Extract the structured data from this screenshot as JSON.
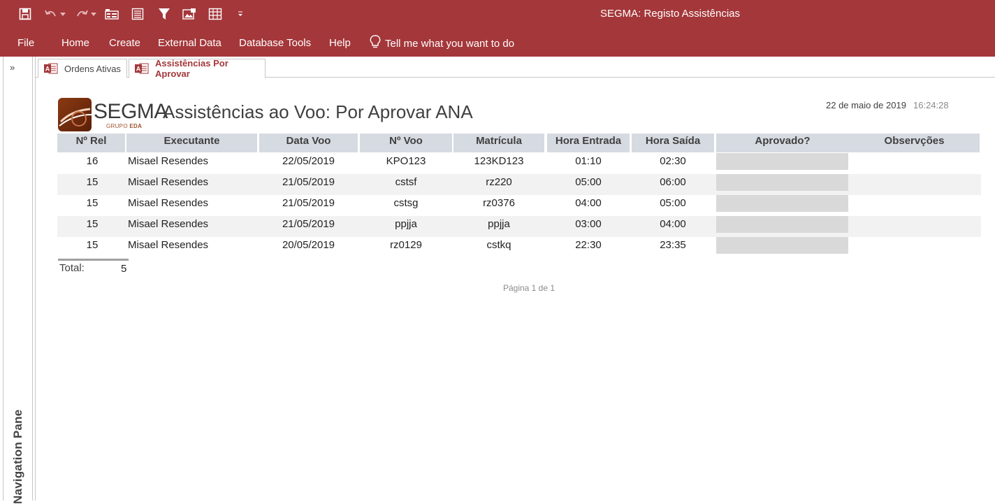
{
  "window": {
    "title": "SEGMA: Registo Assistências"
  },
  "qat": {
    "icons": [
      "save-icon",
      "undo-icon",
      "redo-icon",
      "form-icon",
      "report-icon",
      "filter-icon",
      "image-icon",
      "table-icon",
      "customize-icon"
    ]
  },
  "menu": {
    "items": [
      "File",
      "Home",
      "Create",
      "External Data",
      "Database Tools",
      "Help"
    ],
    "tellme": "Tell me what you want to do"
  },
  "nav": {
    "label": "Navigation Pane",
    "chevron": "»"
  },
  "tabs": [
    {
      "label": "Ordens Ativas",
      "active": false
    },
    {
      "label": "Assistências Por Aprovar",
      "active": true
    }
  ],
  "report": {
    "logo_text": "SEGMA",
    "logo_sub_a": "GRUPO ",
    "logo_sub_b": "EDA",
    "title": "Assistências ao Voo: Por Aprovar ANA",
    "date": "22 de maio de 2019",
    "time": "16:24:28",
    "columns": [
      "Nº Rel",
      "Executante",
      "Data Voo",
      "Nº Voo",
      "Matrícula",
      "Hora Entrada",
      "Hora Saída",
      "Aprovado?",
      "Observções"
    ],
    "rows": [
      {
        "rel": "16",
        "executante": "Misael Resendes",
        "data": "22/05/2019",
        "voo": "KPO123",
        "matricula": "123KD123",
        "entrada": "01:10",
        "saida": "02:30"
      },
      {
        "rel": "15",
        "executante": "Misael Resendes",
        "data": "21/05/2019",
        "voo": "cstsf",
        "matricula": "rz220",
        "entrada": "05:00",
        "saida": "06:00"
      },
      {
        "rel": "15",
        "executante": "Misael Resendes",
        "data": "21/05/2019",
        "voo": "cstsg",
        "matricula": "rz0376",
        "entrada": "04:00",
        "saida": "05:00"
      },
      {
        "rel": "15",
        "executante": "Misael Resendes",
        "data": "21/05/2019",
        "voo": "ppjja",
        "matricula": "ppjja",
        "entrada": "03:00",
        "saida": "04:00"
      },
      {
        "rel": "15",
        "executante": "Misael Resendes",
        "data": "20/05/2019",
        "voo": "rz0129",
        "matricula": "cstkq",
        "entrada": "22:30",
        "saida": "23:35"
      }
    ],
    "total_label": "Total:",
    "total_value": "5",
    "page": "Página 1 de 1"
  },
  "colors": {
    "accent": "#a4373a",
    "header_bg": "#d6dae1",
    "alt_row": "#f2f2f2"
  }
}
